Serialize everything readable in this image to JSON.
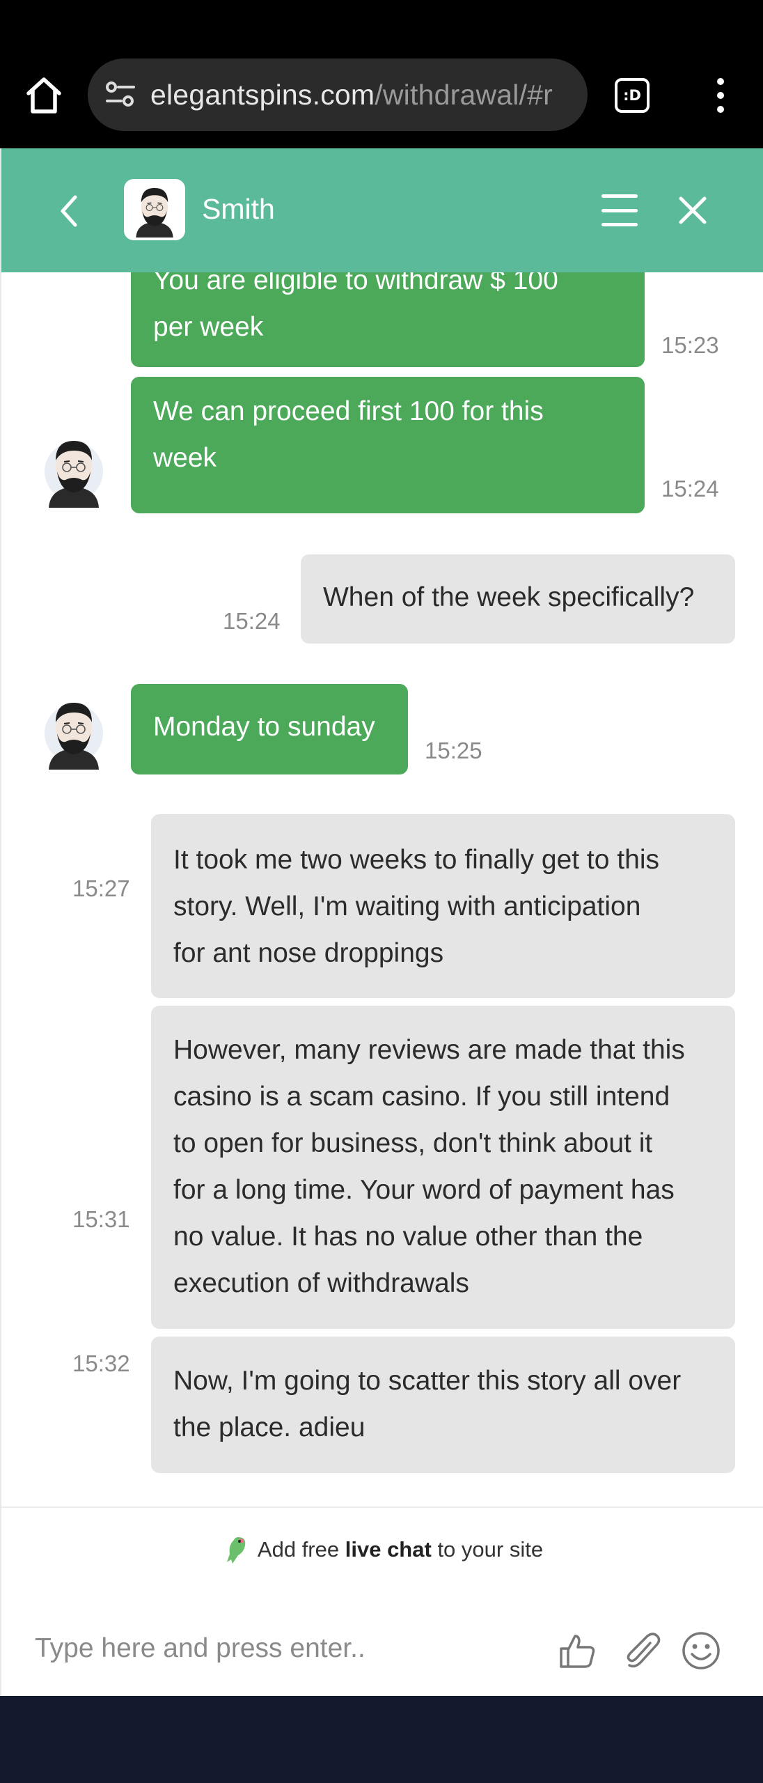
{
  "browser": {
    "url_domain": "elegantspins.com",
    "url_path": "/withdrawal/#r",
    "tab_label": ":D"
  },
  "chat_header": {
    "agent_name": "Smith"
  },
  "messages": [
    {
      "from": "agent",
      "lines": [
        "You are eligible to withdraw $ 100",
        "per week"
      ],
      "time": "15:23"
    },
    {
      "from": "agent",
      "lines": [
        "We can proceed first 100 for this",
        "week"
      ],
      "time": "15:24"
    },
    {
      "from": "user",
      "lines": [
        "When of the week specifically?"
      ],
      "time": "15:24"
    },
    {
      "from": "agent",
      "lines": [
        "Monday to sunday"
      ],
      "time": "15:25"
    },
    {
      "from": "user",
      "lines": [
        "It took me two weeks to finally get to this",
        "story. Well, I'm waiting with anticipation",
        "for ant nose droppings"
      ],
      "time": "15:27"
    },
    {
      "from": "user",
      "lines": [
        "However, many reviews are made that this",
        "casino is a scam casino. If you still intend",
        "to open for business, don't think about it",
        "for a long time. Your word of payment has",
        "no value. It has no value other than the",
        "execution of withdrawals"
      ],
      "time": "15:31"
    },
    {
      "from": "user",
      "lines": [
        "Now, I'm going to scatter this story all over",
        "the place. adieu"
      ],
      "time": "15:32"
    }
  ],
  "footer": {
    "promo_prefix": "Add free",
    "promo_bold": "live chat",
    "promo_suffix": "to your site",
    "input_placeholder": "Type here and press enter.."
  },
  "icons": {
    "home": "home-icon",
    "site_settings": "tune-icon",
    "tabs": "tabs-icon",
    "more": "more-vert-icon",
    "back": "chevron-left-icon",
    "menu": "hamburger-icon",
    "close": "close-icon",
    "thumb": "thumbs-up-icon",
    "attach": "paperclip-icon",
    "emoji": "smiley-icon",
    "parrot": "parrot-logo-icon"
  },
  "colors": {
    "header_bg": "#5bba9a",
    "agent_bubble": "#4ca95a",
    "user_bubble": "#e5e5e5",
    "page_bottom": "#131a2e"
  }
}
